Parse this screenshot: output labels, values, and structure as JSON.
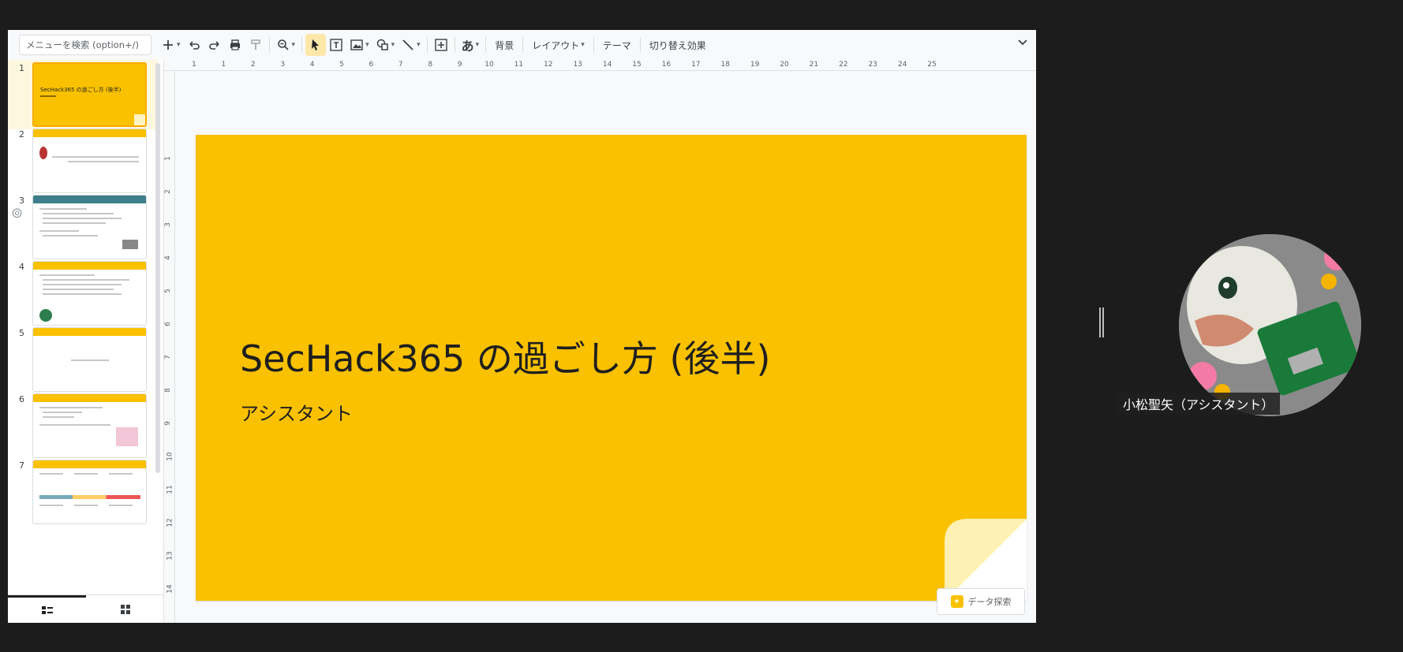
{
  "toolbar": {
    "search_placeholder": "メニューを検索 (option+/)",
    "font_button": "あ",
    "background": "背景",
    "layout": "レイアウト",
    "theme": "テーマ",
    "transition": "切り替え効果"
  },
  "ruler": {
    "top": [
      "1",
      "1",
      "2",
      "3",
      "4",
      "5",
      "6",
      "7",
      "8",
      "9",
      "10",
      "11",
      "12",
      "13",
      "14",
      "15",
      "16",
      "17",
      "18",
      "19",
      "20",
      "21",
      "22",
      "23",
      "24",
      "25"
    ],
    "left": [
      "1",
      "2",
      "3",
      "4",
      "5",
      "6",
      "7",
      "8",
      "9",
      "10",
      "11",
      "12",
      "13",
      "14"
    ]
  },
  "filmstrip": {
    "slides": [
      {
        "number": "1",
        "title": "SecHack365 の過ごし方 (後半)"
      },
      {
        "number": "2"
      },
      {
        "number": "3"
      },
      {
        "number": "4"
      },
      {
        "number": "5"
      },
      {
        "number": "6"
      },
      {
        "number": "7"
      }
    ]
  },
  "slide": {
    "title": "SecHack365 の過ごし方 (後半)",
    "subtitle": "アシスタント"
  },
  "explore_button": "データ探索",
  "participant": {
    "name": "小松聖矢（アシスタント）"
  },
  "colors": {
    "slide_background": "#f9c100",
    "accent_selected": "#f9ab00"
  }
}
